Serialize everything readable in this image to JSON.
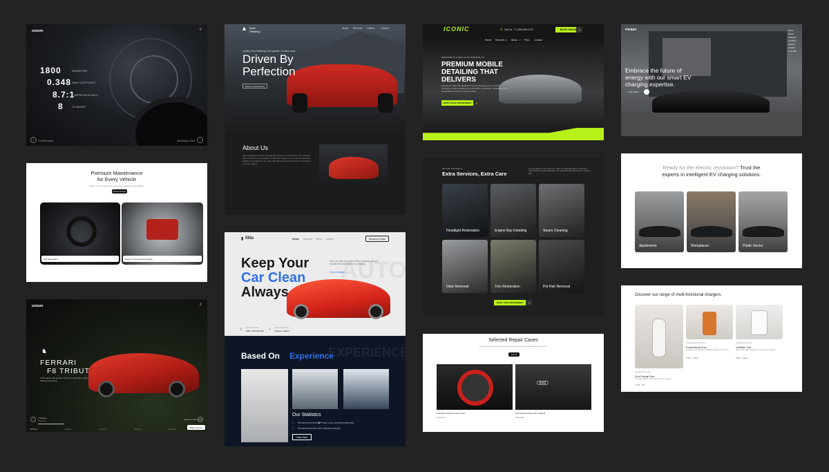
{
  "colors": {
    "background": "#232323",
    "lime": "#b8f01a",
    "blue": "#2f6fe8",
    "red": "#c8201c"
  },
  "card_dashboard": {
    "brand": "ezizem",
    "stats": [
      {
        "value": "1800",
        "label": "ENGINE RPM"
      },
      {
        "value": "0.348",
        "label": "DRAG COEFFICIENT"
      },
      {
        "value": "8.7:1",
        "label": "COMPRESSION RATIO"
      },
      {
        "value": "8",
        "label": "CYLINDERS"
      }
    ],
    "footer_left": "Full Recovery",
    "footer_right": "Machinery, 2024"
  },
  "card_driven": {
    "brand": "Apex Detailing",
    "nav": [
      "About",
      "Services",
      "Gallery",
      "Contact"
    ],
    "tagline": "Quality auto detailing in the greater Houston area",
    "title_line1": "Driven By",
    "title_line2": "Perfection",
    "cta": "Book an appointment",
    "about_title": "About Us",
    "about_text": "Apex Detailing has been serving the Houston community for over 10 years. Our commitment to perfection is what has made us one of the trusted and reliable car detailers in the area. We offer services from interior cleaning to ceramic coating."
  },
  "card_iconic": {
    "logo": "ICONIC",
    "phone": "Call Us: +1 (785) 555-0747",
    "book": "BOOK ONLINE",
    "nav": [
      "Home",
      "Services",
      "About",
      "FAQ",
      "Contact"
    ],
    "welcome": "WELCOME TO ICONIC AUTO DETAILING CO",
    "title_line1": "PREMIUM MOBILE",
    "title_line2": "DETAILING THAT",
    "title_line3": "DELIVERS",
    "sub": "Experience elite auto aesthetics at your doorstep. From ceramic coatings to engine detailing, we specialize in perfection, protection, and personalized service for every vehicle.",
    "cta": "BOOK YOUR APPOINTMENT"
  },
  "card_ev_hero": {
    "brand": "rocase",
    "menu": [
      "Home",
      "About",
      "Chargers",
      "Solutions",
      "Support",
      "Contact",
      "Let's Talk"
    ],
    "title_line1": "Embrace the future of",
    "title_line2": "energy with our smart EV",
    "title_line3": "charging expertise.",
    "cta": "Learn More"
  },
  "card_premium": {
    "title_line1": "Premium Maintenance",
    "title_line2": "for Every Vehicle",
    "sub": "Expert care for uncompromised safety, durability, and reliability.",
    "cta": "Explore Services",
    "items": [
      "Full Diagnostics",
      "Engine & Performance Repair"
    ]
  },
  "card_services": {
    "eyebrow": "BEYOND THE BASICS",
    "title": "Extra Services, Extra Care",
    "text": "You can discover more than just a wash. Our specialty add-ons help bring back that fresh, factory-fresh look, and will extend each and ensure it looks its best.",
    "tiles": [
      "Headlight Restoration",
      "Engine Bay Detailing",
      "Steam Cleaning",
      "Odor Removal",
      "Trim Restoration",
      "Pet Hair Removal"
    ],
    "cta": "BOOK YOUR APPOINTMENT"
  },
  "card_ready": {
    "title_gray": "Ready for the electric revolution?",
    "title_dark_1": "Trust the",
    "title_dark_2": "experts in intelligent EV charging solutions.",
    "tiles": [
      "Apartments",
      "Workplaces",
      "Public Sector"
    ]
  },
  "card_fillio": {
    "logo": "fillio",
    "nav": [
      "Home",
      "Services",
      "About",
      "Contact"
    ],
    "quote": "Request A Quote",
    "title_line1": "Keep Your",
    "title_line2": "Car Clean",
    "title_line3": "Always",
    "desc": "Fillio car wash is a brand which is literally going to change the people think car cleaning.",
    "read_more": "Know A Wash",
    "call_label": "CALL US NOW",
    "call_value": "+088 0 000 000 000",
    "loc_label": "OUR LOCATION",
    "loc_value": "Shibgonj, Sylhet",
    "watermark": "AUTO",
    "based_on": "Based On",
    "experience": "Experience",
    "watermark2": "EXPERIENCE",
    "stats_title": "Our Statistics",
    "stat1_pre": "We have more than",
    "stat1_num": "10+",
    "stat1_post": "Years of our services experience.",
    "stat2": "We have more than 130+ Vehicles serviced.",
    "learn_more": "Learn More"
  },
  "card_ferrari": {
    "brand": "ezizem",
    "title_line1": "FERRARI",
    "title_line2": "F8 TRIBUTO",
    "sub": "A V8 engine that pushes 710 hp to new limits, optimized for a thrilling experience.",
    "left_label": "2 Wheels",
    "left_sub": "Segment",
    "right_label": "Engine Performance",
    "nav": [
      "Model 1",
      "Model 2",
      "Model 3",
      "Model 4",
      "Model 5"
    ],
    "button": "Build a Ferrari"
  },
  "card_chargers": {
    "title": "Discover our range of multi-functional chargers.",
    "products": [
      {
        "cat": "Charging Point (AC)",
        "name": "EcoCharge Duo",
        "desc": "Compact design, optimized for limited spaces.",
        "meta": "7.4kW · 16A"
      },
      {
        "cat": "Charging Point (AC/DC)",
        "name": "PowerBoost Duo",
        "desc": "Simultaneous charging capability, balancing efficiency.",
        "meta": "11kW · 2 plugs"
      },
      {
        "cat": "Charging Point (DC)",
        "name": "VoltMax Trio",
        "desc": "Heavy duty, high charging for up to three vehicles.",
        "meta": "22kW · 3 plugs"
      }
    ]
  },
  "card_repair": {
    "title": "Selected Repair Cases",
    "sub": "See how we transformed worn-out brakes and engines into reliable performers.",
    "cta": "View All",
    "items": [
      {
        "title": "Full Brake Replacement & Disc",
        "link": "View Case"
      },
      {
        "title": "Audi Engine Diagnostic & Repair",
        "link": "View Case"
      }
    ]
  }
}
